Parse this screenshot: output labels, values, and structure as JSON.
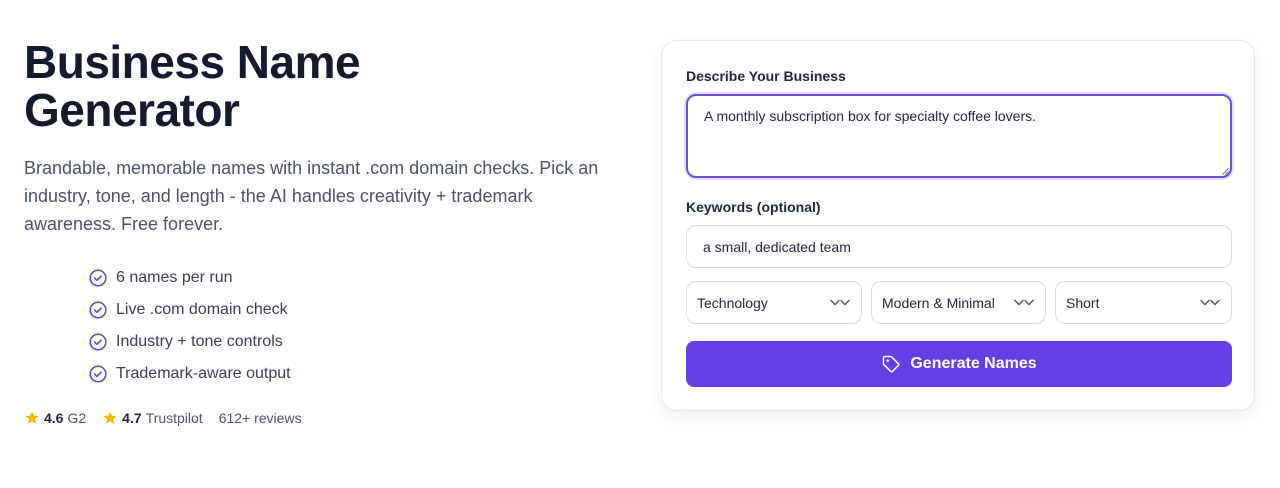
{
  "hero": {
    "title_line1": "Business Name",
    "title_line2": "Generator",
    "subtitle": "Brandable, memorable names with instant .com domain checks. Pick an industry, tone, and length - the AI handles creativity + trademark awareness. Free forever.",
    "features": [
      "6 names per run",
      "Live .com domain check",
      "Industry + tone controls",
      "Trademark-aware output"
    ],
    "ratings": [
      {
        "score": "4.6",
        "source": "G2"
      },
      {
        "score": "4.7",
        "source": "Trustpilot"
      }
    ],
    "reviews": "612+ reviews"
  },
  "form": {
    "description_label": "Describe Your Business",
    "description_value": "A monthly subscription box for specialty coffee lovers.",
    "keywords_label": "Keywords (optional)",
    "keywords_value": "a small, dedicated team",
    "industry_selected": "Technology",
    "tone_selected": "Modern & Minimal",
    "length_selected": "Short",
    "generate_label": "Generate Names"
  },
  "colors": {
    "accent": "#6440e6",
    "check": "#5b3fd6",
    "star": "#f5b80b"
  },
  "icons": {
    "feature": "check-circle-icon",
    "rating": "star-icon",
    "select": "chevron-down-icon",
    "generate": "tag-icon"
  }
}
